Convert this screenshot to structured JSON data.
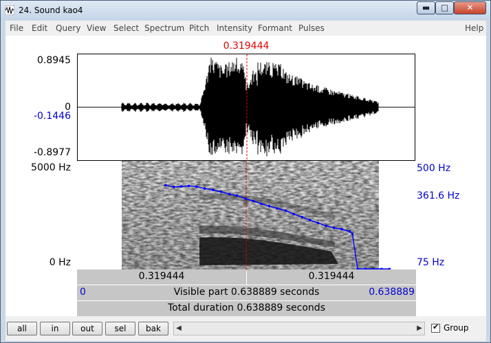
{
  "window": {
    "title": "24. Sound kao4"
  },
  "title_buttons": {
    "minimize": "▬",
    "maximize": "□",
    "close": "✕"
  },
  "menu": [
    "File",
    "Edit",
    "Query",
    "View",
    "Select",
    "Spectrum",
    "Pitch",
    "Intensity",
    "Formant",
    "Pulses",
    "Help"
  ],
  "cursor": {
    "time_label": "0.319444"
  },
  "waveform": {
    "ymax": "0.8945",
    "zero": "0",
    "cursor_value": "-0.1446",
    "ymin": "-0.8977"
  },
  "spectrogram": {
    "freq_max": "5000 Hz",
    "freq_min": "0 Hz",
    "pitch_max": "500 Hz",
    "pitch_cursor": "361.6 Hz",
    "pitch_min": "75 Hz"
  },
  "bars": {
    "left_part": "0.319444",
    "right_part": "0.319444",
    "visible_start": "0",
    "visible_text": "Visible part 0.638889 seconds",
    "visible_end": "0.638889",
    "total_text": "Total duration 0.638889 seconds"
  },
  "buttons": {
    "all": "all",
    "in": "in",
    "out": "out",
    "sel": "sel",
    "bak": "bak"
  },
  "scroll": {
    "left": "◀",
    "right": "▶"
  },
  "group": {
    "label": "Group",
    "checked": "✔"
  },
  "colors": {
    "cursor": "#e00000",
    "pitch": "#0000ff",
    "label_blue": "#0000cc"
  },
  "pitch_contour": {
    "t": [
      0.167,
      0.183,
      0.197,
      0.211,
      0.226,
      0.241,
      0.257,
      0.272,
      0.288,
      0.302,
      0.318,
      0.333,
      0.348,
      0.363,
      0.378,
      0.394,
      0.409,
      0.425,
      0.44,
      0.455,
      0.47,
      0.485,
      0.5,
      0.515,
      0.52,
      0.53,
      0.545,
      0.56,
      0.575,
      0.59
    ],
    "hz": [
      405,
      398,
      400,
      402,
      399,
      392,
      386,
      379,
      370,
      364,
      352,
      343,
      332,
      323,
      314,
      305,
      292,
      280,
      268,
      257,
      246,
      238,
      232,
      224,
      214,
      77,
      77,
      77,
      77,
      77
    ]
  }
}
